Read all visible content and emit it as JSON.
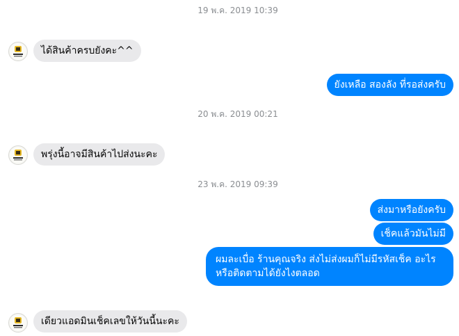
{
  "conversation": {
    "timestamps": [
      "19 พ.ค. 2019 10:39",
      "20 พ.ค. 2019 00:21",
      "23 พ.ค. 2019 09:39"
    ],
    "messages": [
      {
        "sender": "shop",
        "text": "ได้สินค้าครบยังคะ^^"
      },
      {
        "sender": "me",
        "text": "ยังเหลือ สองลัง ที่รอส่งครับ"
      },
      {
        "sender": "shop",
        "text": "พรุ่งนี้อาจมีสินค้าไปส่งนะคะ"
      },
      {
        "sender": "me",
        "text": "ส่งมาหรือยังครับ"
      },
      {
        "sender": "me",
        "text": "เช็คแล้วมันไม่มี"
      },
      {
        "sender": "me",
        "text": "ผมละเบื่อ ร้านคุณจริง ส่งไม่ส่งผมก็ไม่มีรหัสเช็ค อะไร หรือติดตามได้ยังไงตลอด"
      },
      {
        "sender": "shop",
        "text": "เดียวแอดมินเช็คเลขให้วันนี้นะคะ"
      }
    ]
  },
  "colors": {
    "incoming_bubble": "#e9e9eb",
    "outgoing_bubble": "#0084ff",
    "timestamp_text": "#8a8d91"
  },
  "icons": {
    "avatar": "shop-logo-avatar"
  }
}
